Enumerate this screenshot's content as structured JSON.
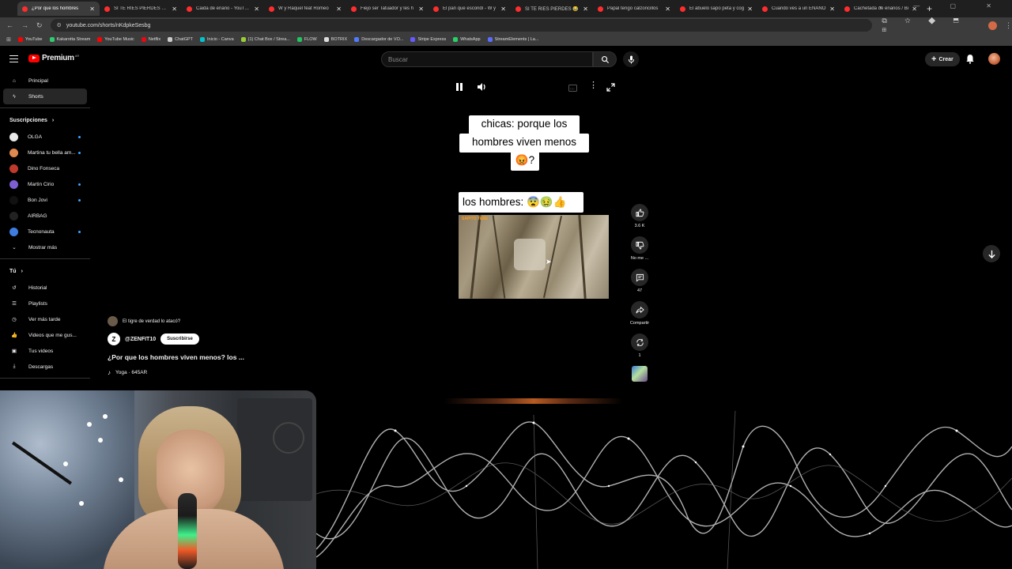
{
  "browser": {
    "tabs": [
      {
        "label": "¿Por que los hombres",
        "active": true
      },
      {
        "label": "SI TE RÍES PIERDES NIVEL"
      },
      {
        "label": "Caida de enano - YouTube"
      },
      {
        "label": "W y Raquel feat Romeo"
      },
      {
        "label": "Fiejo ser Tatuador y les h"
      },
      {
        "label": "El pan que escondí - W y"
      },
      {
        "label": "SI TE RÍES PIERDES 😂"
      },
      {
        "label": "Papal tengo calzoncillos"
      },
      {
        "label": "El abuelo sapo peta y cog"
      },
      {
        "label": "Cuando ves a un ENANO"
      },
      {
        "label": "Cachetada de enanos / Bi"
      }
    ],
    "url": "youtube.com/shorts/nKdpkeSesbg",
    "bookmarks": [
      {
        "label": "YouTube",
        "color": "#ff0000"
      },
      {
        "label": "Kakarotta Stream",
        "color": "#2ecc71"
      },
      {
        "label": "YouTube Music",
        "color": "#ff0000"
      },
      {
        "label": "Netflix",
        "color": "#e50914"
      },
      {
        "label": "ChatGPT",
        "color": "#cccccc"
      },
      {
        "label": "Inicio - Canva",
        "color": "#00c4cc"
      },
      {
        "label": "(1) Chat Box / Strea...",
        "color": "#9acd32"
      },
      {
        "label": "FLOW",
        "color": "#22c55e"
      },
      {
        "label": "BOTRIX",
        "color": "#dddddd"
      },
      {
        "label": "Descargador de VO...",
        "color": "#4f7cff"
      },
      {
        "label": "Stripe Express",
        "color": "#635bff"
      },
      {
        "label": "WhatsApp",
        "color": "#25d366"
      },
      {
        "label": "StreamElements | La...",
        "color": "#5b6cff"
      }
    ]
  },
  "youtube": {
    "logo_text": "Premium",
    "logo_region": "AR",
    "search_placeholder": "Buscar",
    "create_label": "Crear",
    "sidebar": {
      "main": [
        {
          "label": "Principal",
          "icon": "home-icon"
        },
        {
          "label": "Shorts",
          "icon": "shorts-icon",
          "active": true
        }
      ],
      "subscriptions_heading": "Suscripciones",
      "subscriptions": [
        {
          "label": "OLGA",
          "color": "#e8e8e8",
          "new": true
        },
        {
          "label": "Martina tu bella am...",
          "color": "#e0894f",
          "new": true
        },
        {
          "label": "Dino Fonseca",
          "color": "#c0392b",
          "new": false
        },
        {
          "label": "Martin Cirio",
          "color": "#7d5fd3",
          "new": true
        },
        {
          "label": "Bon Jovi",
          "color": "#111111",
          "new": true
        },
        {
          "label": "AIRBAG",
          "color": "#222222",
          "new": false
        },
        {
          "label": "Tecnonauta",
          "color": "#3f7de0",
          "new": true
        }
      ],
      "show_more": "Mostrar más",
      "you_heading": "Tú",
      "you_items": [
        {
          "label": "Historial",
          "icon": "history-icon"
        },
        {
          "label": "Playlists",
          "icon": "playlists-icon"
        },
        {
          "label": "Ver más tarde",
          "icon": "watch-later-icon"
        },
        {
          "label": "Videos que me gus...",
          "icon": "liked-videos-icon"
        },
        {
          "label": "Tus videos",
          "icon": "your-videos-icon"
        },
        {
          "label": "Descargas",
          "icon": "downloads-icon"
        }
      ]
    },
    "short": {
      "caption_line1": "chicas: porque los",
      "caption_line2": "hombres viven menos",
      "caption_line3": "😡?",
      "caption_bottom": "los hombres: 😨🤢👍",
      "video_logo": "SAPITO TEBE",
      "actions": {
        "likes": "3.6 K",
        "dislike": "No me ...",
        "comments": "47",
        "share": "Compartir",
        "remix": "1"
      }
    },
    "meta": {
      "suggestion": "El tigre de verdad lo atacó?",
      "channel_initial": "Z",
      "channel": "@ZENFIT10",
      "subscribe": "Suscribirse",
      "title": "¿Por que los hombres viven menos?  los ...",
      "sound": "Yoga · 645AR"
    }
  }
}
